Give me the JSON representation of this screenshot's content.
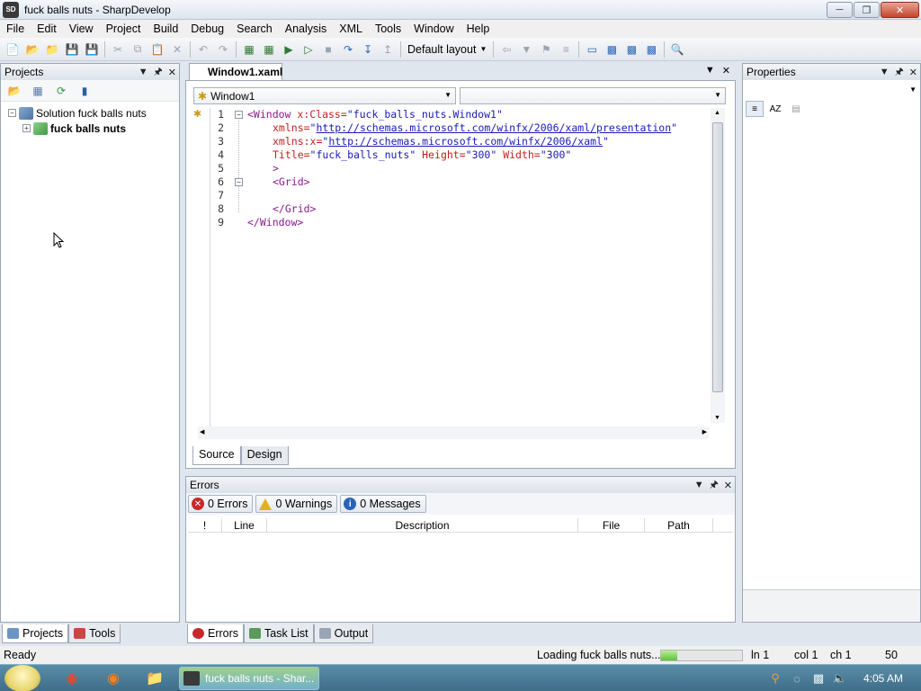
{
  "window": {
    "title": "fuck balls nuts - SharpDevelop",
    "app_icon_text": "SD",
    "buttons": [
      "minimize",
      "maximize",
      "close"
    ]
  },
  "menu": [
    "File",
    "Edit",
    "View",
    "Project",
    "Build",
    "Debug",
    "Search",
    "Analysis",
    "XML",
    "Tools",
    "Window",
    "Help"
  ],
  "toolbar": {
    "layout_select": "Default layout"
  },
  "projects_pad": {
    "title": "Projects",
    "tree": {
      "solution": "Solution fuck balls nuts",
      "project": "fuck balls nuts"
    }
  },
  "editor": {
    "tab": "Window1.xaml",
    "class_combo": "Window1",
    "member_combo": "",
    "line_numbers": [
      "1",
      "2",
      "3",
      "4",
      "5",
      "6",
      "7",
      "8",
      "9"
    ],
    "code": {
      "l1_open": "<Window",
      "l1_attr": " x:Class=",
      "l1_val": "\"fuck_balls_nuts.Window1\"",
      "l2_attr": "xmlns=",
      "l2_q1": "\"",
      "l2_link": "http://schemas.microsoft.com/winfx/2006/xaml/presentation",
      "l2_q2": "\"",
      "l3_attr": "xmlns:x=",
      "l3_q1": "\"",
      "l3_link": "http://schemas.microsoft.com/winfx/2006/xaml",
      "l3_q2": "\"",
      "l4_attr1": "Title=",
      "l4_val1": "\"fuck_balls_nuts\"",
      "l4_attr2": " Height=",
      "l4_val2": "\"300\"",
      "l4_attr3": " Width=",
      "l4_val3": "\"300\"",
      "l5": ">",
      "l6": "<Grid>",
      "l8": "</Grid>",
      "l9": "</Window>"
    },
    "view_tabs": [
      "Source",
      "Design"
    ]
  },
  "errors_pad": {
    "title": "Errors",
    "filters": {
      "errors": "0 Errors",
      "warnings": "0 Warnings",
      "messages": "0 Messages"
    },
    "columns": [
      "!",
      "Line",
      "Description",
      "File",
      "Path"
    ]
  },
  "bottom_tabs": {
    "left": [
      "Projects",
      "Tools"
    ],
    "center": [
      "Errors",
      "Task List",
      "Output"
    ]
  },
  "properties_pad": {
    "title": "Properties"
  },
  "statusbar": {
    "status": "Ready",
    "loading": "Loading fuck balls nuts...",
    "progress_fraction": 0.2,
    "line": "ln 1",
    "col": "col 1",
    "ch": "ch 1",
    "extra": "50"
  },
  "taskbar": {
    "task_label": "fuck balls nuts - Shar...",
    "clock": "4:05 AM"
  }
}
